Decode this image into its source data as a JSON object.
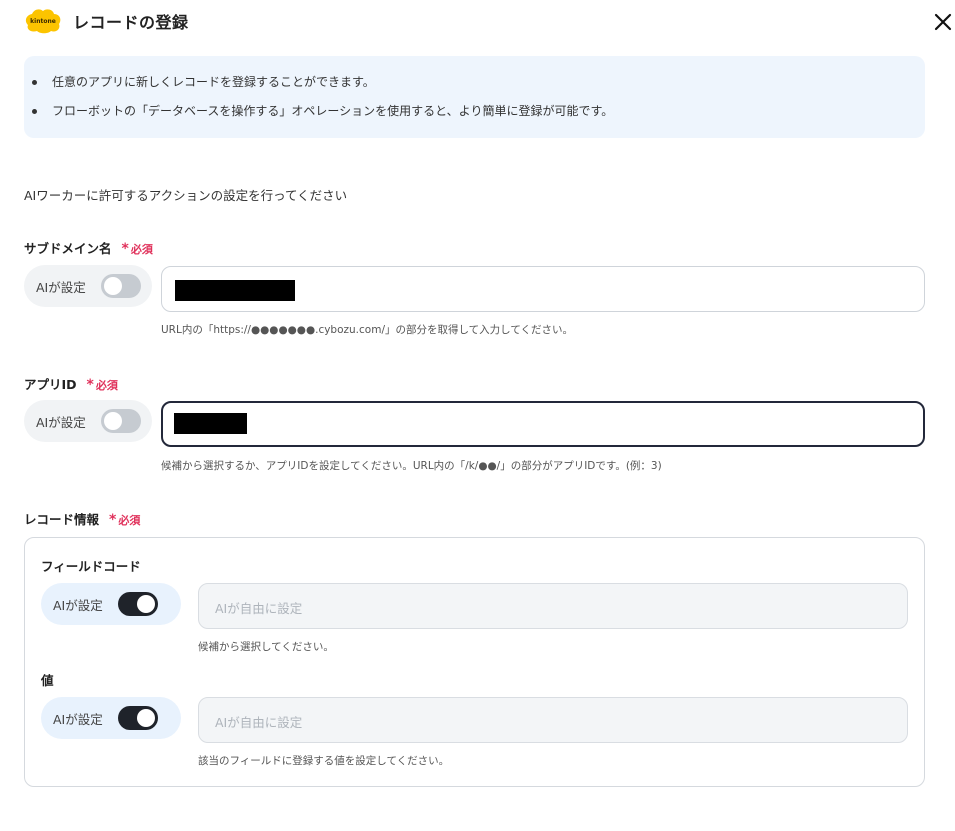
{
  "header": {
    "logo_text": "kintone",
    "title": "レコードの登録",
    "close_icon": "close-icon"
  },
  "info": {
    "items": [
      "任意のアプリに新しくレコードを登録することができます。",
      "フローボットの「データベースを操作する」オペレーションを使用すると、より簡単に登録が可能です。"
    ]
  },
  "intro": "AIワーカーに許可するアクションの設定を行ってください",
  "required_label": "必須",
  "ai_label": "AIが設定",
  "fields": {
    "subdomain": {
      "label": "サブドメイン名",
      "ai_enabled": false,
      "value": "",
      "help": "URL内の「https://●●●●●●●.cybozu.com/」の部分を取得して入力してください。"
    },
    "app_id": {
      "label": "アプリID",
      "ai_enabled": false,
      "value": "",
      "help": "候補から選択するか、アプリIDを設定してください。URL内の「/k/●●/」の部分がアプリIDです。(例：3)"
    },
    "record_info": {
      "label": "レコード情報",
      "field_code": {
        "label": "フィールドコード",
        "ai_enabled": true,
        "placeholder": "AIが自由に設定",
        "help": "候補から選択してください。"
      },
      "value": {
        "label": "値",
        "ai_enabled": true,
        "placeholder": "AIが自由に設定",
        "help": "該当のフィールドに登録する値を設定してください。"
      }
    }
  },
  "colors": {
    "accent_required": "#e0315b",
    "info_bg": "#eef5fd",
    "toggle_on": "#1f232a",
    "toggle_off": "#c6cbd1",
    "logo_yellow": "#fcc400"
  }
}
